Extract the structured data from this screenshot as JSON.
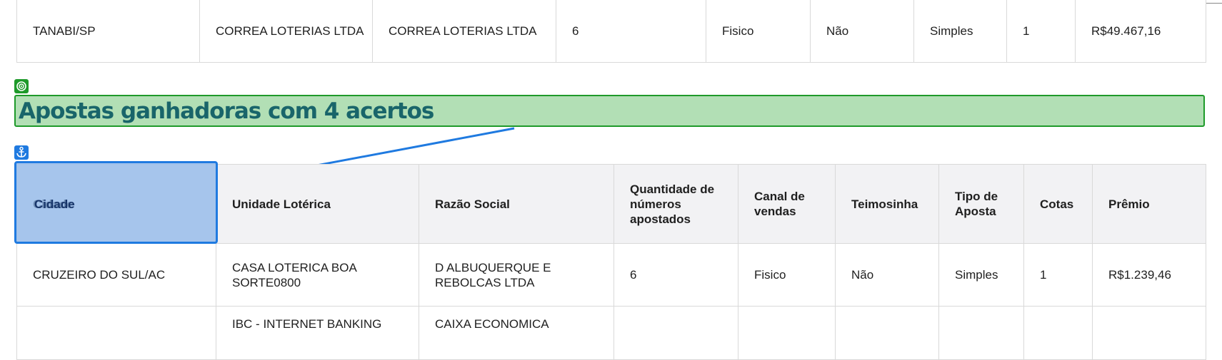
{
  "top_row": {
    "cidade": "TANABI/SP",
    "unidade": "CORREA LOTERIAS LTDA",
    "razao": "CORREA LOTERIAS LTDA",
    "quantidade": "6",
    "canal": "Fisico",
    "teimosinha": "Não",
    "tipo": "Simples",
    "cotas": "1",
    "premio": "R$49.467,16"
  },
  "section": {
    "heading": "Apostas ganhadoras com 4 acertos"
  },
  "icons": {
    "heading_badge": "target-icon",
    "cell_badge": "anchor-icon"
  },
  "table": {
    "headers": {
      "cidade": "Cidade",
      "unidade": "Unidade Lotérica",
      "razao": "Razão Social",
      "quantidade": "Quantidade de números apostados",
      "canal": "Canal de vendas",
      "teimosinha": "Teimosinha",
      "tipo": "Tipo de Aposta",
      "cotas": "Cotas",
      "premio": "Prêmio"
    },
    "rows": [
      {
        "cidade": "CRUZEIRO DO SUL/AC",
        "unidade": "CASA LOTERICA BOA SORTE0800",
        "razao": "D ALBUQUERQUE E REBOLCAS LTDA",
        "quantidade": "6",
        "canal": "Fisico",
        "teimosinha": "Não",
        "tipo": "Simples",
        "cotas": "1",
        "premio": "R$1.239,46"
      },
      {
        "unidade": "IBC - INTERNET BANKING",
        "razao": "CAIXA ECONOMICA"
      }
    ]
  },
  "colors": {
    "heading_bg": "#b2dfb5",
    "heading_border": "#1e9a2a",
    "heading_text": "#19656a",
    "highlight_border": "#1f7ae0"
  }
}
